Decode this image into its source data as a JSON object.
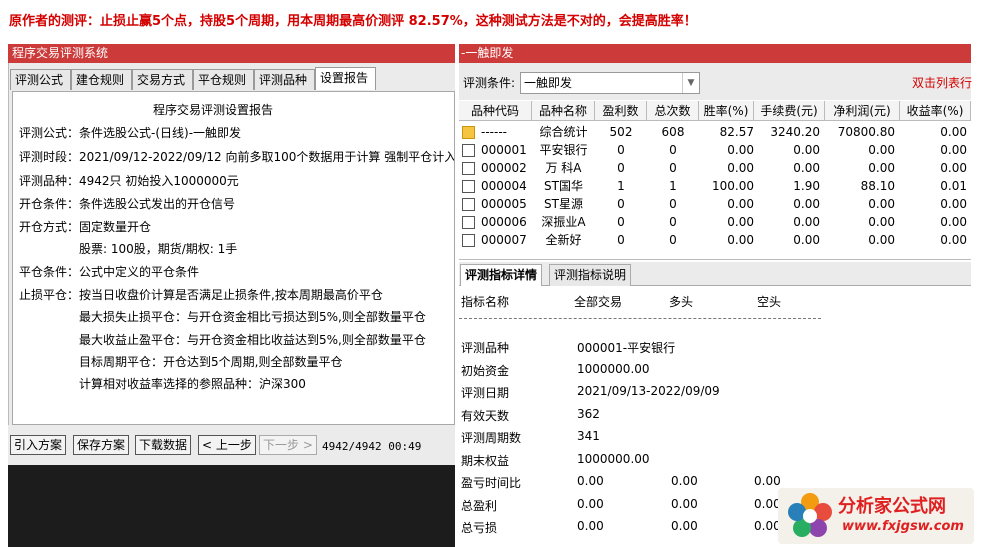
{
  "headline": "原作者的测评：止损止赢5个点，持股5个周期，用本周期最高价测评 82.57%，这种测试方法是不对的，会提高胜率！",
  "left_window": {
    "title": "程序交易评测系统",
    "tabs": [
      "评测公式",
      "建仓规则",
      "交易方式",
      "平仓规则",
      "评测品种",
      "设置报告"
    ],
    "active_tab": 5,
    "report": {
      "heading": "程序交易评测设置报告",
      "lines": [
        "评测公式：条件选股公式-(日线)-一触即发",
        "评测时段：2021/09/12-2022/09/12 向前多取100个数据用于计算 强制平仓计入收",
        "评测品种：4942只 初始投入1000000元",
        "开仓条件：条件选股公式发出的开仓信号",
        "开仓方式：固定数量开仓",
        "股票: 100股，期货/期权: 1手",
        "平仓条件：公式中定义的平仓条件",
        "止损平仓：按当日收盘价计算是否满足止损条件,按本周期最高价平仓",
        "最大损失止损平仓：与开仓资金相比亏损达到5%,则全部数量平仓",
        "最大收益止盈平仓：与开仓资金相比收益达到5%,则全部数量平仓",
        "目标周期平仓：开仓达到5个周期,则全部数量平仓",
        "计算相对收益率选择的参照品种：沪深300"
      ]
    },
    "buttons": {
      "import": "引入方案",
      "save": "保存方案",
      "download": "下载数据",
      "prev": "< 上一步",
      "next": "下一步 >"
    },
    "progress_text": "4942/4942 00:49"
  },
  "right_window": {
    "title": "-一触即发",
    "condition_label": "评测条件:",
    "condition_value": "一触即发",
    "dbl_click_hint": "双击列表行",
    "grid": {
      "headers": [
        "品种代码",
        "品种名称",
        "盈利数",
        "总次数",
        "胜率(%)",
        "手续费(元)",
        "净利润(元)",
        "收益率(%)"
      ],
      "rows": [
        [
          "------",
          "综合统计",
          "502",
          "608",
          "82.57",
          "3240.20",
          "70800.80",
          "0.00"
        ],
        [
          "000001",
          "平安银行",
          "0",
          "0",
          "0.00",
          "0.00",
          "0.00",
          "0.00"
        ],
        [
          "000002",
          "万 科A",
          "0",
          "0",
          "0.00",
          "0.00",
          "0.00",
          "0.00"
        ],
        [
          "000004",
          "ST国华",
          "1",
          "1",
          "100.00",
          "1.90",
          "88.10",
          "0.01"
        ],
        [
          "000005",
          "ST星源",
          "0",
          "0",
          "0.00",
          "0.00",
          "0.00",
          "0.00"
        ],
        [
          "000006",
          "深振业A",
          "0",
          "0",
          "0.00",
          "0.00",
          "0.00",
          "0.00"
        ],
        [
          "000007",
          "全新好",
          "0",
          "0",
          "0.00",
          "0.00",
          "0.00",
          "0.00"
        ]
      ]
    },
    "detail_tabs": [
      "评测指标详情",
      "评测指标说明"
    ],
    "active_detail_tab": 0,
    "detail": {
      "headers": [
        "指标名称",
        "全部交易",
        "多头",
        "空头"
      ],
      "rows": [
        [
          "评测品种",
          "000001-平安银行",
          "",
          ""
        ],
        [
          "初始资金",
          "1000000.00",
          "",
          ""
        ],
        [
          "评测日期",
          "2021/09/13-2022/09/09",
          "",
          ""
        ],
        [
          "有效天数",
          "362",
          "",
          ""
        ],
        [
          "评测周期数",
          "341",
          "",
          ""
        ],
        [
          "期末权益",
          "1000000.00",
          "",
          ""
        ],
        [
          "盈亏时间比",
          "0.00",
          "0.00",
          "0.00"
        ],
        [
          "总盈利",
          "0.00",
          "0.00",
          "0.00"
        ],
        [
          "总亏损",
          "0.00",
          "0.00",
          "0.00"
        ]
      ]
    }
  },
  "logo": {
    "name": "分析家公式网",
    "url": "www.fxjgsw.com"
  },
  "colors": {
    "title_bar": "#cc3a3a",
    "headline": "#d40000",
    "logo_red": "#e02020"
  }
}
